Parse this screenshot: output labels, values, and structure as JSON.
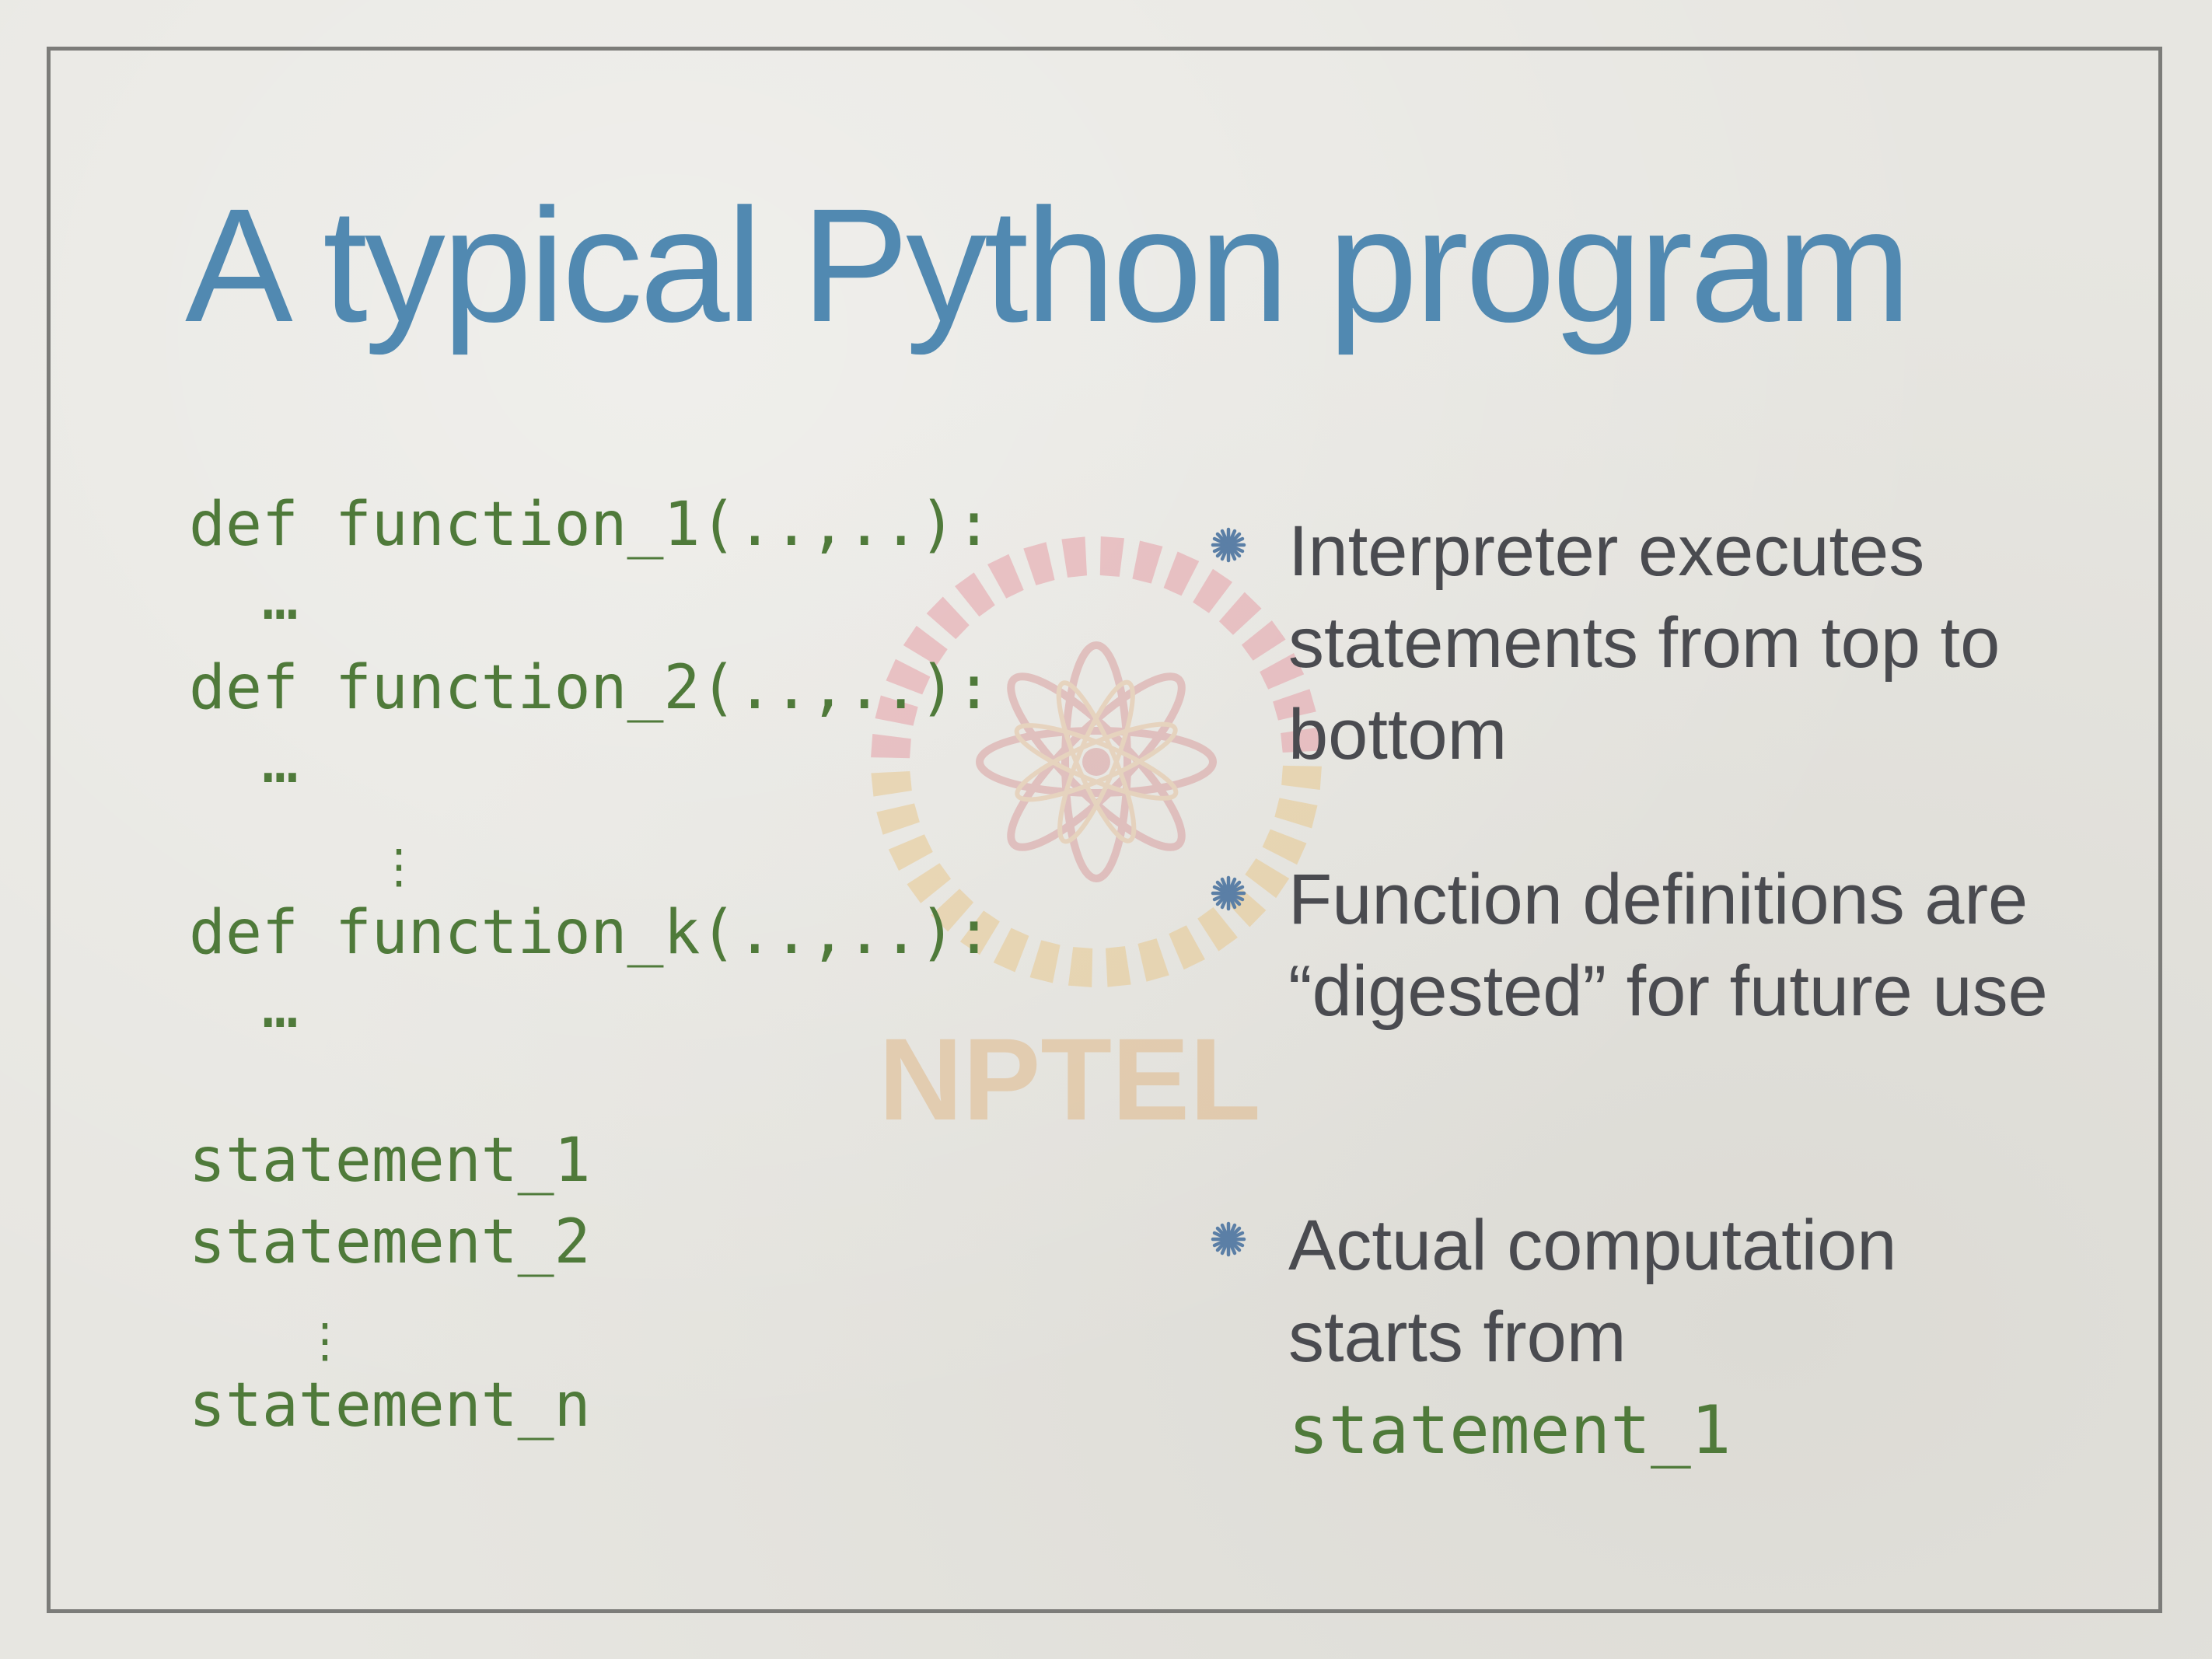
{
  "slide": {
    "title": "A typical Python program",
    "watermark_text": "NPTEL",
    "code_lines": [
      "def function_1(..,..):",
      "  …",
      "def function_2(..,..):",
      "  …",
      "def function_k(..,..):",
      "  …",
      "statement_1",
      "statement_2",
      "statement_n"
    ],
    "vertical_ellipsis": "⋮",
    "bullets": [
      {
        "text": "Interpreter executes statements from top to bottom"
      },
      {
        "text": "Function definitions are “digested” for future use"
      },
      {
        "text": "Actual computation starts from",
        "code": "statement_1"
      }
    ],
    "colors": {
      "title": "#5189b1",
      "code": "#4f7a3a",
      "body_text": "#4a4b50",
      "bullet_star": "#5b7fa6",
      "frame": "#7c7c79"
    }
  }
}
